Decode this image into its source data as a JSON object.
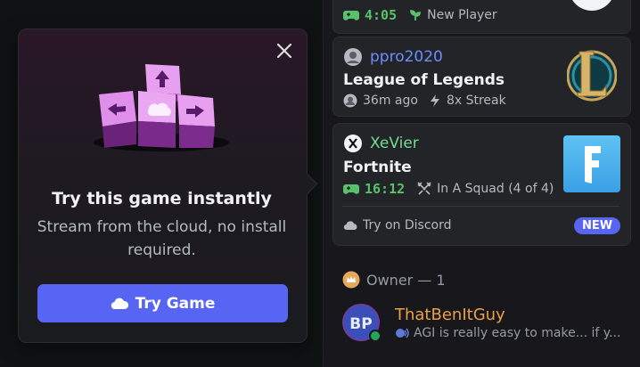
{
  "popup": {
    "title": "Try this game instantly",
    "description": "Stream from the cloud, no install required.",
    "button_label": "Try Game"
  },
  "cards": {
    "top": {
      "time": "4:05",
      "badge": "New Player"
    },
    "lol": {
      "username": "ppro2020",
      "game": "League of Legends",
      "ago": "36m ago",
      "streak": "8x Streak"
    },
    "fortnite": {
      "username": "XeVier",
      "game": "Fortnite",
      "time": "16:12",
      "squad": "In A Squad (4 of 4)",
      "try_on": "Try on Discord",
      "new_badge": "NEW"
    }
  },
  "members": {
    "section_label": "Owner — 1",
    "owner": {
      "name": "ThatBenItGuy",
      "status": "AGI is really easy to make... if y...",
      "avatar_text": "BP"
    }
  },
  "colors": {
    "accent": "#5865f2",
    "green": "#57c26b",
    "owner_name": "#e8a04a"
  }
}
